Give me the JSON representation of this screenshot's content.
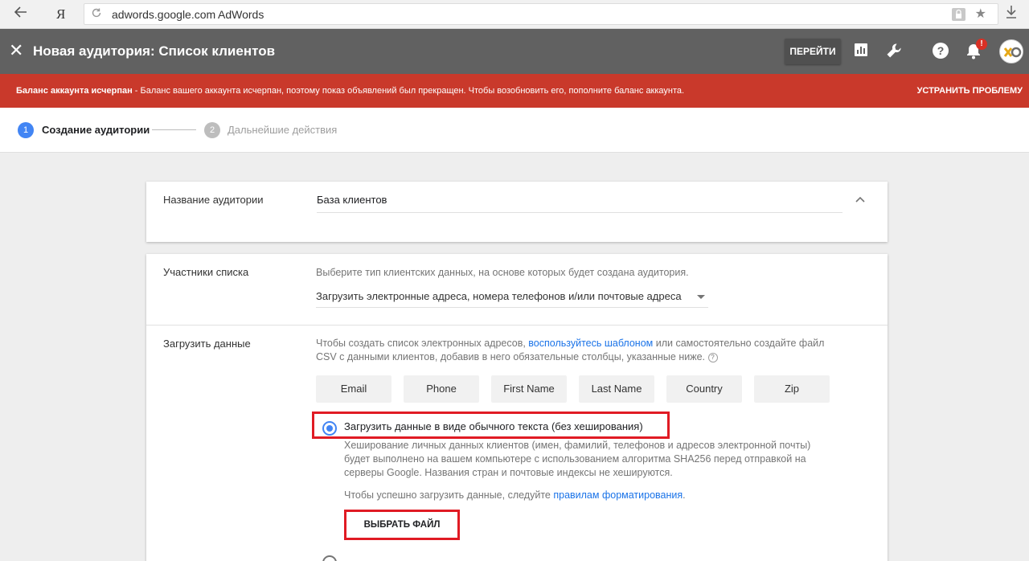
{
  "browser": {
    "ya_label": "Я",
    "host": "adwords.google.com",
    "page_title": "AdWords"
  },
  "header": {
    "title": "Новая аудитория: Список клиентов",
    "go_label": "ПЕРЕЙТИ",
    "notification_badge": "!"
  },
  "alert": {
    "bold": "Баланс аккаунта исчерпан",
    "text": " - Баланс вашего аккаунта исчерпан, поэтому показ объявлений был прекращен. Чтобы возобновить его, пополните баланс аккаунта.",
    "fix_label": "УСТРАНИТЬ ПРОБЛЕМУ",
    "color": "#c9392b"
  },
  "stepper": {
    "step1_num": "1",
    "step1_label": "Создание аудитории",
    "step2_num": "2",
    "step2_label": "Дальнейшие действия"
  },
  "audience_name": {
    "label": "Название аудитории",
    "value": "База клиентов"
  },
  "members": {
    "label": "Участники списка",
    "hint": "Выберите тип клиентских данных, на основе которых будет создана аудитория.",
    "selected": "Загрузить электронные адреса, номера телефонов и/или почтовые адреса"
  },
  "upload": {
    "label": "Загрузить данные",
    "desc_part1": "Чтобы создать список электронных адресов, ",
    "desc_link": "воспользуйтесь шаблоном",
    "desc_part2": " или самостоятельно создайте файл",
    "desc_line2": "CSV с данными клиентов, добавив в него обязательные столбцы, указанные ниже.",
    "columns": [
      "Email",
      "Phone",
      "First Name",
      "Last Name",
      "Country",
      "Zip"
    ],
    "radio_label": "Загрузить данные в виде обычного текста (без хеширования)",
    "hash_line1": "Хеширование личных данных клиентов (имен, фамилий, телефонов и адресов электронной почты)",
    "hash_line2": "будет выполнено на вашем компьютере с использованием алгоритма SHA256 перед отправкой на",
    "hash_line3": "серверы Google. Названия стран и почтовые индексы не хешируются.",
    "format_prefix": "Чтобы успешно загрузить данные, следуйте ",
    "format_link": "правилам форматирования",
    "format_suffix": ".",
    "choose_file": "ВЫБРАТЬ ФАЙЛ"
  },
  "colors": {
    "accent": "#4285f4",
    "highlight": "#e01b24",
    "link": "#1a73e8"
  }
}
